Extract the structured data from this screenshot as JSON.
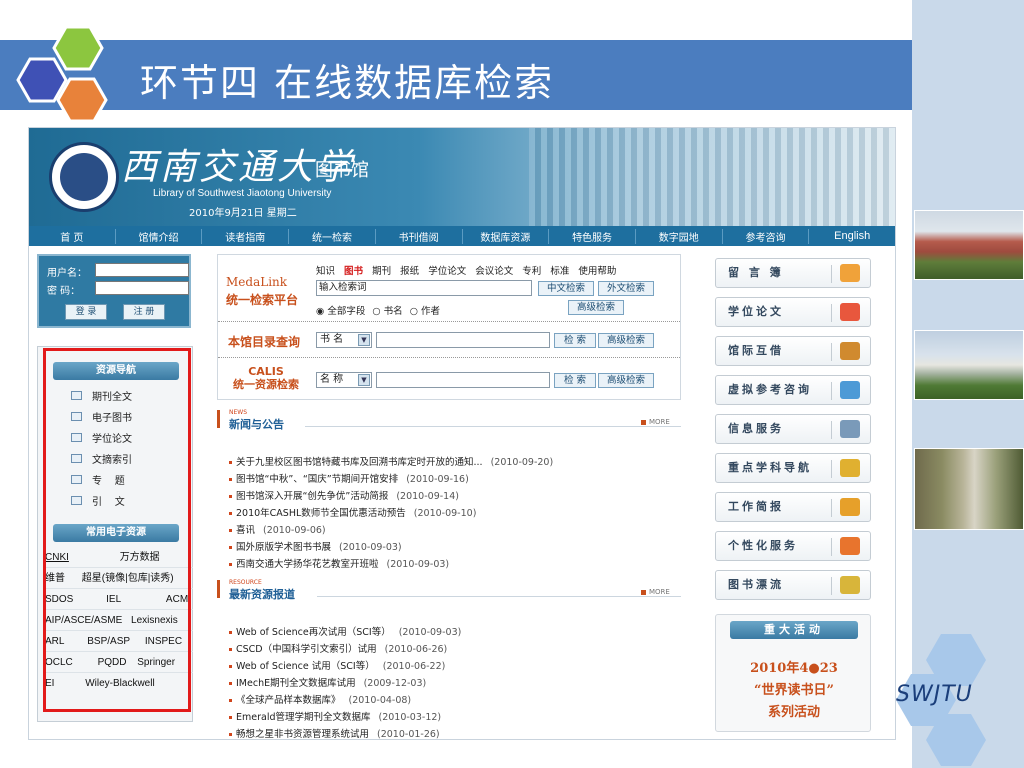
{
  "slide": {
    "title": "环节四  在线数据库检索",
    "brand": "SWJTU"
  },
  "site": {
    "name": "西南交通大学",
    "library": "图书馆",
    "english_name": "Library of Southwest Jiaotong University",
    "date": "2010年9月21日 星期二"
  },
  "nav": [
    "首  页",
    "馆情介绍",
    "读者指南",
    "统一检索",
    "书刊借阅",
    "数据库资源",
    "特色服务",
    "数字园地",
    "参考咨询",
    "English"
  ],
  "login": {
    "username_label": "用户名：",
    "password_label": "密  码：",
    "login_button": "登 录",
    "register_button": "注 册"
  },
  "resources": {
    "nav_title": "资源导航",
    "items": [
      "期刊全文",
      "电子图书",
      "学位论文",
      "文摘索引",
      "专    题",
      "引    文"
    ],
    "common_title": "常用电子资源",
    "databases": [
      [
        "CNKI",
        "万方数据"
      ],
      [
        "维普",
        "超星(镜像|包库|读秀)"
      ],
      [
        "SDOS",
        "IEL",
        "ACM"
      ],
      [
        "AIP/ASCE/ASME",
        "Lexisnexis"
      ],
      [
        "ARL",
        "BSP/ASP",
        "INSPEC"
      ],
      [
        "OCLC",
        "PQDD",
        "Springer"
      ],
      [
        "EI",
        "Wiley-Blackwell"
      ]
    ]
  },
  "search": {
    "medalink_logo": "MedaLink",
    "medalink_title": "统一检索平台",
    "types": [
      "知识",
      "图书",
      "期刊",
      "报纸",
      "学位论文",
      "会议论文",
      "专利",
      "标准",
      "使用帮助"
    ],
    "active_type": "图书",
    "query_value": "输入检索词",
    "cn_search": "中文检索",
    "foreign_search": "外文检索",
    "advanced": "高级检索",
    "radio_all": "全部字段",
    "radio_title": "书名",
    "radio_author": "作者",
    "catalog_title": "本馆目录查询",
    "catalog_select": "书 名",
    "search_button": "检 索",
    "calis_title": "CALIS",
    "calis_sub": "统一资源检索",
    "calis_select": "名 称"
  },
  "news": {
    "en_label": "NEWS",
    "title": "新闻与公告",
    "more": "MORE",
    "items": [
      {
        "text": "关于九里校区图书馆特藏书库及回溯书库定时开放的通知...",
        "date": "(2010-09-20)"
      },
      {
        "text": "图书馆“中秋”、“国庆”节期间开馆安排",
        "date": "(2010-09-16)"
      },
      {
        "text": "图书馆深入开展“创先争优”活动简报",
        "date": "(2010-09-14)"
      },
      {
        "text": "2010年CASHL数师节全国优惠活动预告",
        "date": "(2010-09-10)"
      },
      {
        "text": "喜讯",
        "date": "(2010-09-06)"
      },
      {
        "text": "国外原版学术图书书展",
        "date": "(2010-09-03)"
      },
      {
        "text": "西南交通大学扬华花艺教室开班啦",
        "date": "(2010-09-03)"
      }
    ]
  },
  "resources_news": {
    "en_label": "RESOURCE",
    "title": "最新资源报道",
    "more": "MORE",
    "items": [
      {
        "text": "Web of Science再次试用（SCI等）",
        "date": "(2010-09-03)"
      },
      {
        "text": "CSCD（中国科学引文索引）试用",
        "date": "(2010-06-26)"
      },
      {
        "text": "Web of Science 试用（SCI等）",
        "date": "(2010-06-22)"
      },
      {
        "text": "IMechE期刊全文数据库试用",
        "date": "(2009-12-03)"
      },
      {
        "text": "《全球产品样本数据库》",
        "date": "(2010-04-08)"
      },
      {
        "text": "Emerald管理学期刊全文数据库",
        "date": "(2010-03-12)"
      },
      {
        "text": "畅想之星非书资源管理系统试用",
        "date": "(2010-01-26)"
      }
    ]
  },
  "side_buttons": [
    "留 言 簿",
    "学位论文",
    "馆际互借",
    "虚拟参考咨询",
    "信息服务",
    "重点学科导航",
    "工作简报",
    "个性化服务",
    "图书漂流"
  ],
  "side_icon_colors": [
    "#f0a23a",
    "#e8573d",
    "#d08a2f",
    "#4d9ad6",
    "#7a9ab9",
    "#e0b030",
    "#e6a02a",
    "#e8742d",
    "#d8b53a"
  ],
  "event": {
    "head": "重大活动",
    "line1": "2010年4●23",
    "line2": "“世界读书日”",
    "line3": "系列活动"
  },
  "colors": {
    "slide_band": "#4b7dbf",
    "hex_green": "#8cc63f",
    "hex_blue": "#3f51b5",
    "hex_orange": "#e8823a",
    "highlight_frame": "#e21a1a"
  }
}
